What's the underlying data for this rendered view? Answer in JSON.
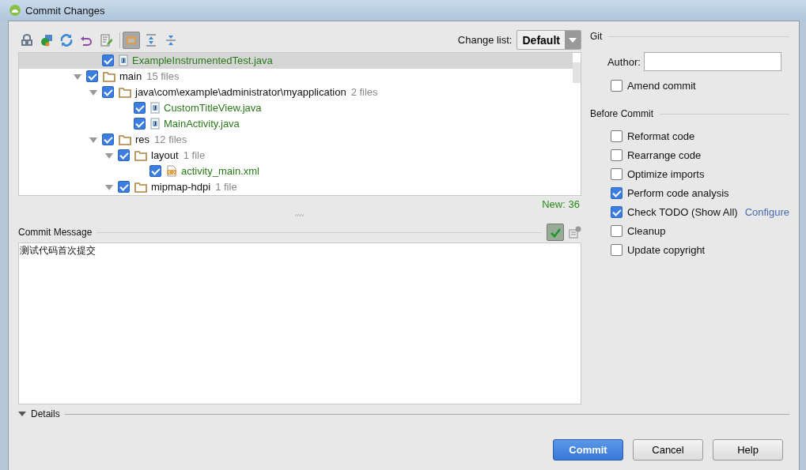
{
  "window": {
    "title": "Commit Changes"
  },
  "toolbar": [
    {
      "kind": "diff",
      "selected": false
    },
    {
      "kind": "move",
      "selected": false
    },
    {
      "kind": "refresh",
      "selected": false
    },
    {
      "kind": "undo",
      "selected": false
    },
    {
      "kind": "edit",
      "selected": false
    },
    {
      "kind": "group",
      "selected": true
    },
    {
      "kind": "expand",
      "selected": false
    },
    {
      "kind": "collapse",
      "selected": false
    }
  ],
  "change_list": {
    "label": "Change list:",
    "value": "Default"
  },
  "tree": [
    {
      "name": "ExampleInstrumentedTest.java",
      "kind": "java",
      "checked": true,
      "selected": true
    },
    {
      "name": "main",
      "kind": "folder",
      "count": "15 files",
      "checked": true,
      "selected": false,
      "expanded": true,
      "children": [
        {
          "name": "java\\com\\example\\administrator\\myapplication",
          "kind": "folder",
          "count": "2 files",
          "checked": true,
          "selected": false,
          "expanded": true,
          "children": [
            {
              "name": "CustomTitleView.java",
              "kind": "java",
              "checked": true,
              "selected": false
            },
            {
              "name": "MainActivity.java",
              "kind": "java",
              "checked": true,
              "selected": false
            }
          ]
        },
        {
          "name": "res",
          "kind": "folder",
          "count": "12 files",
          "checked": true,
          "selected": false,
          "expanded": true,
          "children": [
            {
              "name": "layout",
              "kind": "folder",
              "count": "1 file",
              "checked": true,
              "selected": false,
              "expanded": true,
              "children": [
                {
                  "name": "activity_main.xml",
                  "kind": "xml",
                  "checked": true,
                  "selected": false
                }
              ]
            },
            {
              "name": "mipmap-hdpi",
              "kind": "folder",
              "count": "1 file",
              "checked": true,
              "selected": false,
              "expanded": true
            }
          ]
        }
      ]
    }
  ],
  "new_count": "New: 36",
  "commit_message": {
    "label": "Commit Message",
    "value": "测试代码首次提交"
  },
  "details": {
    "label": "Details"
  },
  "git": {
    "title": "Git",
    "author_label": "Author:",
    "amend": {
      "label": "Amend commit",
      "checked": false
    }
  },
  "before_commit": {
    "title": "Before Commit",
    "options": [
      {
        "label": "Reformat code",
        "checked": false
      },
      {
        "label": "Rearrange code",
        "checked": false
      },
      {
        "label": "Optimize imports",
        "checked": false
      },
      {
        "label": "Perform code analysis",
        "checked": true
      },
      {
        "label": "Check TODO (Show All)",
        "checked": true,
        "link": "Configure"
      },
      {
        "label": "Cleanup",
        "checked": false
      },
      {
        "label": "Update copyright",
        "checked": false
      }
    ]
  },
  "buttons": [
    {
      "label": "Commit",
      "kind": "primary"
    },
    {
      "label": "Cancel",
      "kind": "normal"
    },
    {
      "label": "Help",
      "kind": "normal"
    }
  ]
}
